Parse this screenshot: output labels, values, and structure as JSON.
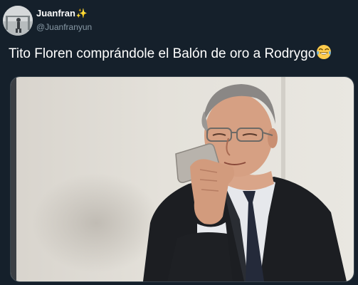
{
  "tweet": {
    "author": {
      "display_name": "Juanfran",
      "name_emoji": "✨",
      "handle": "@Juanfranyun",
      "avatar": "avatar-photo"
    },
    "text": "Tito Floren comprándole el Balón de oro a Rodrygo",
    "text_emoji": "face-with-tears-of-joy-icon",
    "media": {
      "type": "photo",
      "subject": "man in dark suit holding a phone to his ear"
    }
  },
  "colors": {
    "background": "#15202b",
    "text": "#ffffff",
    "secondary_text": "#8899a6",
    "border": "#38444d",
    "sparkle": "#f7c31a"
  }
}
